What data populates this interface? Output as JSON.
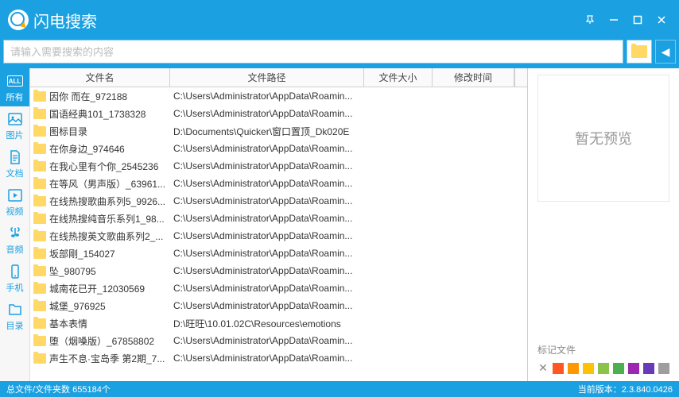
{
  "app": {
    "title": "闪电搜索"
  },
  "search": {
    "placeholder": "请输入需要搜索的内容"
  },
  "sidebar": [
    {
      "label": "所有",
      "badge": "ALL"
    },
    {
      "label": "图片"
    },
    {
      "label": "文档"
    },
    {
      "label": "视频"
    },
    {
      "label": "音频"
    },
    {
      "label": "手机"
    },
    {
      "label": "目录"
    }
  ],
  "columns": {
    "name": "文件名",
    "path": "文件路径",
    "size": "文件大小",
    "time": "修改时间"
  },
  "rows": [
    {
      "name": "因你 而在_972188",
      "path": "C:\\Users\\Administrator\\AppData\\Roamin..."
    },
    {
      "name": "国语经典101_1738328",
      "path": "C:\\Users\\Administrator\\AppData\\Roamin..."
    },
    {
      "name": "图标目录",
      "path": "D:\\Documents\\Quicker\\窗口置顶_Dk020E"
    },
    {
      "name": "在你身边_974646",
      "path": "C:\\Users\\Administrator\\AppData\\Roamin..."
    },
    {
      "name": "在我心里有个你_2545236",
      "path": "C:\\Users\\Administrator\\AppData\\Roamin..."
    },
    {
      "name": "在等风（男声版）_63961...",
      "path": "C:\\Users\\Administrator\\AppData\\Roamin..."
    },
    {
      "name": "在线热搜歌曲系列5_9926...",
      "path": "C:\\Users\\Administrator\\AppData\\Roamin..."
    },
    {
      "name": "在线热搜纯音乐系列1_98...",
      "path": "C:\\Users\\Administrator\\AppData\\Roamin..."
    },
    {
      "name": "在线热搜英文歌曲系列2_...",
      "path": "C:\\Users\\Administrator\\AppData\\Roamin..."
    },
    {
      "name": "坂部剛_154027",
      "path": "C:\\Users\\Administrator\\AppData\\Roamin..."
    },
    {
      "name": "坠_980795",
      "path": "C:\\Users\\Administrator\\AppData\\Roamin..."
    },
    {
      "name": "城南花已开_12030569",
      "path": "C:\\Users\\Administrator\\AppData\\Roamin..."
    },
    {
      "name": "城堡_976925",
      "path": "C:\\Users\\Administrator\\AppData\\Roamin..."
    },
    {
      "name": "基本表情",
      "path": "D:\\旺旺\\10.01.02C\\Resources\\emotions"
    },
    {
      "name": "堕（烟嗓版）_67858802",
      "path": "C:\\Users\\Administrator\\AppData\\Roamin..."
    },
    {
      "name": "声生不息·宝岛季 第2期_7...",
      "path": "C:\\Users\\Administrator\\AppData\\Roamin..."
    }
  ],
  "preview": {
    "empty": "暂无预览",
    "tagLabel": "标记文件"
  },
  "tagColors": [
    "#ff5722",
    "#ff9800",
    "#ffc107",
    "#8bc34a",
    "#4caf50",
    "#9c27b0",
    "#673ab7",
    "#9e9e9e"
  ],
  "status": {
    "left": "总文件/文件夹数 655184个",
    "right": "当前版本：2.3.840.0426"
  }
}
